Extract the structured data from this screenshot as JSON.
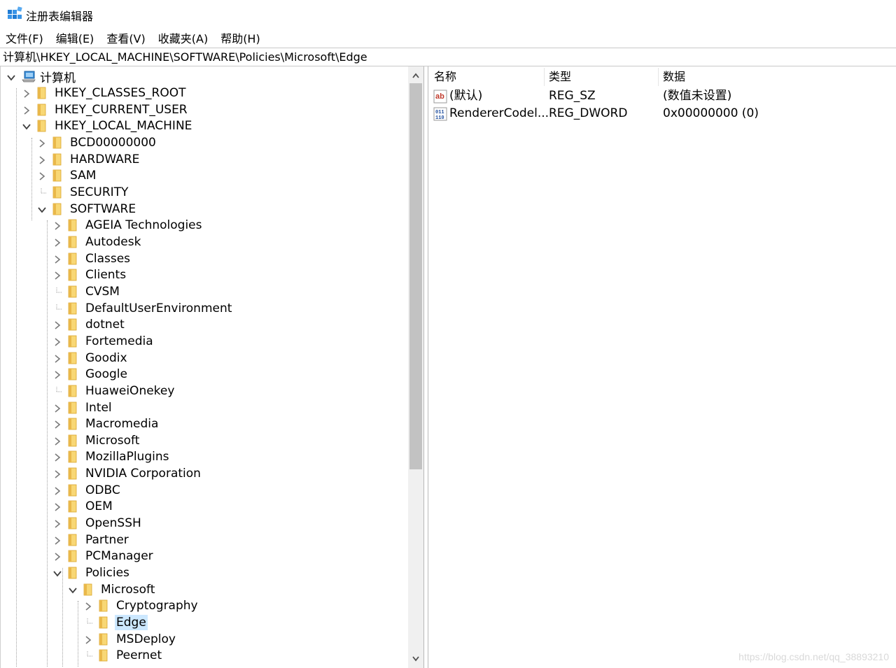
{
  "window": {
    "title": "注册表编辑器"
  },
  "menu": [
    "文件(F)",
    "编辑(E)",
    "查看(V)",
    "收藏夹(A)",
    "帮助(H)"
  ],
  "address": "计算机\\HKEY_LOCAL_MACHINE\\SOFTWARE\\Policies\\Microsoft\\Edge",
  "tree": {
    "root": "计算机",
    "nodes": [
      {
        "label": "HKEY_CLASSES_ROOT",
        "depth": 1,
        "state": "collapsed"
      },
      {
        "label": "HKEY_CURRENT_USER",
        "depth": 1,
        "state": "collapsed"
      },
      {
        "label": "HKEY_LOCAL_MACHINE",
        "depth": 1,
        "state": "expanded"
      },
      {
        "label": "BCD00000000",
        "depth": 2,
        "state": "collapsed"
      },
      {
        "label": "HARDWARE",
        "depth": 2,
        "state": "collapsed"
      },
      {
        "label": "SAM",
        "depth": 2,
        "state": "collapsed"
      },
      {
        "label": "SECURITY",
        "depth": 2,
        "state": "leaf"
      },
      {
        "label": "SOFTWARE",
        "depth": 2,
        "state": "expanded"
      },
      {
        "label": "AGEIA Technologies",
        "depth": 3,
        "state": "collapsed"
      },
      {
        "label": "Autodesk",
        "depth": 3,
        "state": "collapsed"
      },
      {
        "label": "Classes",
        "depth": 3,
        "state": "collapsed"
      },
      {
        "label": "Clients",
        "depth": 3,
        "state": "collapsed"
      },
      {
        "label": "CVSM",
        "depth": 3,
        "state": "leaf"
      },
      {
        "label": "DefaultUserEnvironment",
        "depth": 3,
        "state": "leaf"
      },
      {
        "label": "dotnet",
        "depth": 3,
        "state": "collapsed"
      },
      {
        "label": "Fortemedia",
        "depth": 3,
        "state": "collapsed"
      },
      {
        "label": "Goodix",
        "depth": 3,
        "state": "collapsed"
      },
      {
        "label": "Google",
        "depth": 3,
        "state": "collapsed"
      },
      {
        "label": "HuaweiOnekey",
        "depth": 3,
        "state": "leaf"
      },
      {
        "label": "Intel",
        "depth": 3,
        "state": "collapsed"
      },
      {
        "label": "Macromedia",
        "depth": 3,
        "state": "collapsed"
      },
      {
        "label": "Microsoft",
        "depth": 3,
        "state": "collapsed"
      },
      {
        "label": "MozillaPlugins",
        "depth": 3,
        "state": "collapsed"
      },
      {
        "label": "NVIDIA Corporation",
        "depth": 3,
        "state": "collapsed"
      },
      {
        "label": "ODBC",
        "depth": 3,
        "state": "collapsed"
      },
      {
        "label": "OEM",
        "depth": 3,
        "state": "collapsed"
      },
      {
        "label": "OpenSSH",
        "depth": 3,
        "state": "collapsed"
      },
      {
        "label": "Partner",
        "depth": 3,
        "state": "collapsed"
      },
      {
        "label": "PCManager",
        "depth": 3,
        "state": "collapsed"
      },
      {
        "label": "Policies",
        "depth": 3,
        "state": "expanded"
      },
      {
        "label": "Microsoft",
        "depth": 4,
        "state": "expanded"
      },
      {
        "label": "Cryptography",
        "depth": 5,
        "state": "collapsed"
      },
      {
        "label": "Edge",
        "depth": 5,
        "state": "leaf",
        "selected": true
      },
      {
        "label": "MSDeploy",
        "depth": 5,
        "state": "collapsed"
      },
      {
        "label": "Peernet",
        "depth": 5,
        "state": "leaf"
      }
    ]
  },
  "values": {
    "headers": [
      "名称",
      "类型",
      "数据"
    ],
    "rows": [
      {
        "name": "(默认)",
        "type": "REG_SZ",
        "data": "(数值未设置)",
        "icon": "string-value-icon"
      },
      {
        "name": "RendererCodel...",
        "type": "REG_DWORD",
        "data": "0x00000000 (0)",
        "icon": "binary-value-icon"
      }
    ]
  },
  "watermark": "https://blog.csdn.net/qq_38893210",
  "colors": {
    "selection": "#cce8ff",
    "folder": "#f8d775",
    "scroll_thumb": "#c2c2c2"
  }
}
